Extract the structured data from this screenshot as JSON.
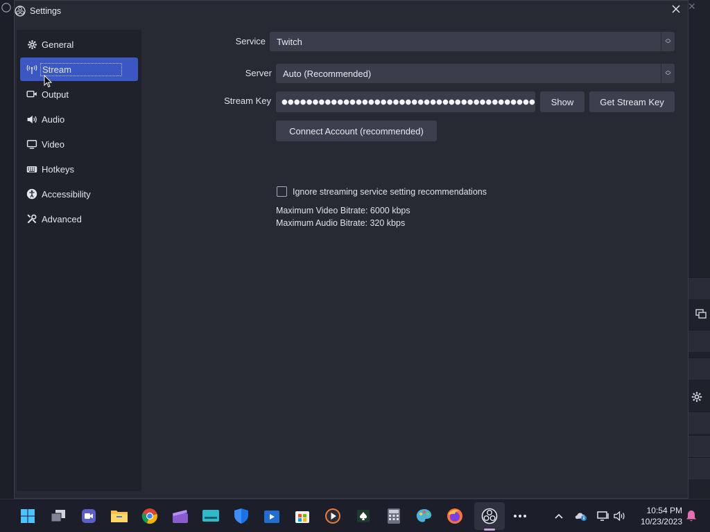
{
  "dialog": {
    "title": "Settings",
    "close_icon": "close-icon"
  },
  "sidebar": {
    "items": [
      {
        "label": "General",
        "icon": "gear-icon"
      },
      {
        "label": "Stream",
        "icon": "antenna-icon",
        "active": true
      },
      {
        "label": "Output",
        "icon": "output-icon"
      },
      {
        "label": "Audio",
        "icon": "speaker-icon"
      },
      {
        "label": "Video",
        "icon": "monitor-icon"
      },
      {
        "label": "Hotkeys",
        "icon": "keyboard-icon"
      },
      {
        "label": "Accessibility",
        "icon": "accessibility-icon"
      },
      {
        "label": "Advanced",
        "icon": "tools-icon"
      }
    ]
  },
  "stream": {
    "service_label": "Service",
    "service_value": "Twitch",
    "server_label": "Server",
    "server_value": "Auto (Recommended)",
    "key_label": "Stream Key",
    "key_value": "●●●●●●●●●●●●●●●●●●●●●●●●●●●●●●●●●●●●●●●●●●●●●●●●●●●●●●●●●●●●●●",
    "show_button": "Show",
    "get_key_button": "Get Stream Key",
    "connect_button": "Connect Account (recommended)",
    "ignore_label": "Ignore streaming service setting recommendations",
    "ignore_checked": false,
    "max_video": "Maximum Video Bitrate: 6000 kbps",
    "max_audio": "Maximum Audio Bitrate: 320 kbps"
  },
  "taskbar": {
    "apps": [
      "start-icon",
      "task-view-icon",
      "meet-icon",
      "file-explorer-icon",
      "chrome-icon",
      "clapperboard-icon",
      "screen-icon",
      "defender-icon",
      "video-editor-icon",
      "store-icon",
      "media-player-icon",
      "solitaire-icon",
      "calculator-icon",
      "paint-icon",
      "firefox-icon",
      "obs-icon",
      "more-icon"
    ],
    "time": "10:54 PM",
    "date": "10/23/2023"
  },
  "colors": {
    "accent": "#3a57c4",
    "dialog_bg": "#272a33",
    "sidebar_bg": "#1f222a",
    "control_bg": "#3a3e4a"
  }
}
